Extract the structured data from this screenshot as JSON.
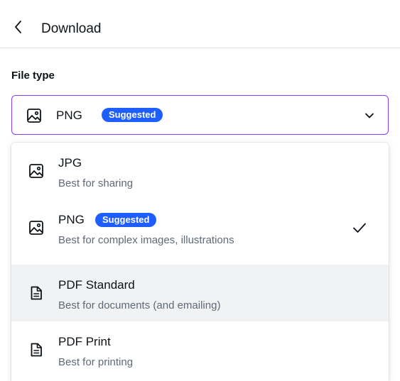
{
  "header": {
    "title": "Download"
  },
  "file_type": {
    "label": "File type",
    "selected_value": "PNG",
    "selected_badge": "Suggested"
  },
  "options": [
    {
      "title": "JPG",
      "description": "Best for sharing",
      "badge": "",
      "icon": "image-icon",
      "selected": false,
      "highlighted": false
    },
    {
      "title": "PNG",
      "description": "Best for complex images, illustrations",
      "badge": "Suggested",
      "icon": "image-icon",
      "selected": true,
      "highlighted": false
    },
    {
      "title": "PDF Standard",
      "description": "Best for documents (and emailing)",
      "badge": "",
      "icon": "document-icon",
      "selected": false,
      "highlighted": true
    },
    {
      "title": "PDF Print",
      "description": "Best for printing",
      "badge": "",
      "icon": "document-icon",
      "selected": false,
      "highlighted": false
    }
  ],
  "colors": {
    "accent_border": "#8b3dff",
    "badge": "#1e5eff",
    "highlight_bg": "#f1f2f4",
    "muted_text": "#5e6a77"
  }
}
